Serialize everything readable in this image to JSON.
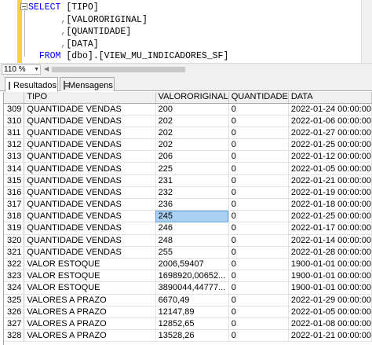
{
  "editor": {
    "lines": [
      {
        "indent": "",
        "kw": "SELECT",
        "rest": " [TIPO]"
      },
      {
        "indent": "      ",
        "kw": "",
        "comma": ",",
        "rest": "[VALORORIGINAL]"
      },
      {
        "indent": "      ",
        "kw": "",
        "comma": ",",
        "rest": "[QUANTIDADE]"
      },
      {
        "indent": "      ",
        "kw": "",
        "comma": ",",
        "rest": "[DATA]"
      },
      {
        "indent": "  ",
        "kw": "FROM",
        "rest": " [dbo].[VIEW_MU_INDICADORES_SF]"
      }
    ]
  },
  "zoom": {
    "value": "110 %"
  },
  "tabs": {
    "results": "Resultados",
    "messages": "Mensagens"
  },
  "grid": {
    "columns": [
      "",
      "TIPO",
      "VALORORIGINAL",
      "QUANTIDADE",
      "DATA"
    ],
    "rows": [
      [
        "309",
        "QUANTIDADE VENDAS",
        "200",
        "0",
        "2022-01-24 00:00:00"
      ],
      [
        "310",
        "QUANTIDADE VENDAS",
        "202",
        "0",
        "2022-01-06 00:00:00"
      ],
      [
        "311",
        "QUANTIDADE VENDAS",
        "202",
        "0",
        "2022-01-27 00:00:00"
      ],
      [
        "312",
        "QUANTIDADE VENDAS",
        "202",
        "0",
        "2022-01-25 00:00:00"
      ],
      [
        "313",
        "QUANTIDADE VENDAS",
        "206",
        "0",
        "2022-01-12 00:00:00"
      ],
      [
        "314",
        "QUANTIDADE VENDAS",
        "225",
        "0",
        "2022-01-05 00:00:00"
      ],
      [
        "315",
        "QUANTIDADE VENDAS",
        "231",
        "0",
        "2022-01-21 00:00:00"
      ],
      [
        "316",
        "QUANTIDADE VENDAS",
        "232",
        "0",
        "2022-01-19 00:00:00"
      ],
      [
        "317",
        "QUANTIDADE VENDAS",
        "236",
        "0",
        "2022-01-18 00:00:00"
      ],
      [
        "318",
        "QUANTIDADE VENDAS",
        "245",
        "0",
        "2022-01-25 00:00:00"
      ],
      [
        "319",
        "QUANTIDADE VENDAS",
        "246",
        "0",
        "2022-01-17 00:00:00"
      ],
      [
        "320",
        "QUANTIDADE VENDAS",
        "248",
        "0",
        "2022-01-14 00:00:00"
      ],
      [
        "321",
        "QUANTIDADE VENDAS",
        "255",
        "0",
        "2022-01-28 00:00:00"
      ],
      [
        "322",
        "VALOR ESTOQUE",
        "2006,59407",
        "0",
        "1900-01-01 00:00:00"
      ],
      [
        "323",
        "VALOR ESTOQUE",
        "1698920,00652...",
        "0",
        "1900-01-01 00:00:00"
      ],
      [
        "324",
        "VALOR ESTOQUE",
        "3890044,44777...",
        "0",
        "1900-01-01 00:00:00"
      ],
      [
        "325",
        "VALORES A PRAZO",
        "6670,49",
        "0",
        "2022-01-29 00:00:00"
      ],
      [
        "326",
        "VALORES A PRAZO",
        "12147,89",
        "0",
        "2022-01-05 00:00:00"
      ],
      [
        "327",
        "VALORES A PRAZO",
        "12852,65",
        "0",
        "2022-01-08 00:00:00"
      ],
      [
        "328",
        "VALORES A PRAZO",
        "13528,26",
        "0",
        "2022-01-21 00:00:00"
      ]
    ],
    "selected_row": "318",
    "selected_column": "VALORORIGINAL"
  },
  "colors": {
    "keyword": "#0000ff",
    "selection": "#aad0f4",
    "change_bar": "#f0d53b"
  }
}
